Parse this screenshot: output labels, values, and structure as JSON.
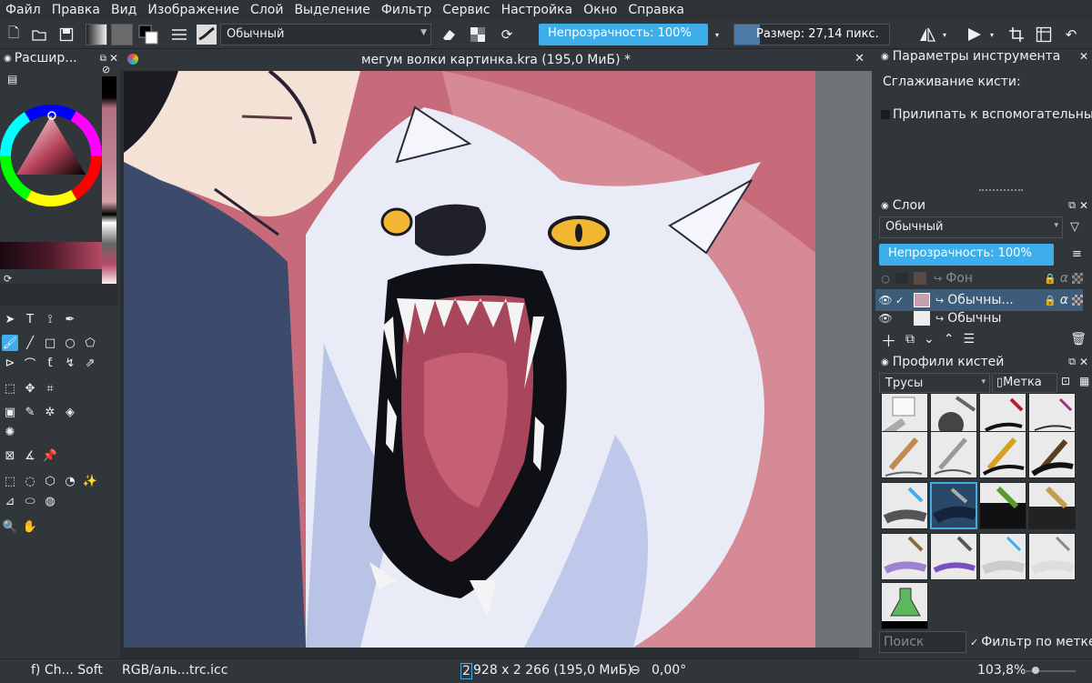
{
  "menu": [
    "Файл",
    "Правка",
    "Вид",
    "Изображение",
    "Слой",
    "Выделение",
    "Фильтр",
    "Сервис",
    "Настройка",
    "Окно",
    "Справка"
  ],
  "toolbar": {
    "blend_mode": "Обычный",
    "opacity_label": "Непрозрачность: 100%",
    "opacity": 1.0,
    "size_label": "Размер: 27,14 пикс."
  },
  "left_dock": {
    "title": "Расшир...",
    "colors": {
      "accent": "#3daee9",
      "current_fg": "#000000"
    }
  },
  "document": {
    "tab_title": "мегум волки картинка.kra (195,0 МиБ) *"
  },
  "tool_options": {
    "title": "Параметры инструмента",
    "smoothing_label": "Сглаживание кисти:",
    "snap_label": "Прилипать к вспомогательным"
  },
  "layers": {
    "title": "Слои",
    "blend_mode": "Обычный",
    "opacity_label": "Непрозрачность:  100%",
    "items": [
      {
        "name": "Фон",
        "visible": false,
        "selected": false
      },
      {
        "name": "Обычны...",
        "visible": true,
        "selected": true
      },
      {
        "name": "Обычны",
        "visible": true,
        "selected": false
      }
    ]
  },
  "brushes": {
    "title": "Профили кистей",
    "tag_combo": "Трусы",
    "tag_button": "Метка",
    "search_placeholder": "Поиск",
    "filter_label": "Фильтр по метке"
  },
  "status": {
    "brush": "f) Ch... Soft",
    "colorspace": "RGB/аль...trc.icc",
    "dimension_width": "2",
    "dimension_rest": "928 x 2 266 (195,0 МиБ)",
    "rotation": "0,00°",
    "zoom": "103,8%"
  }
}
